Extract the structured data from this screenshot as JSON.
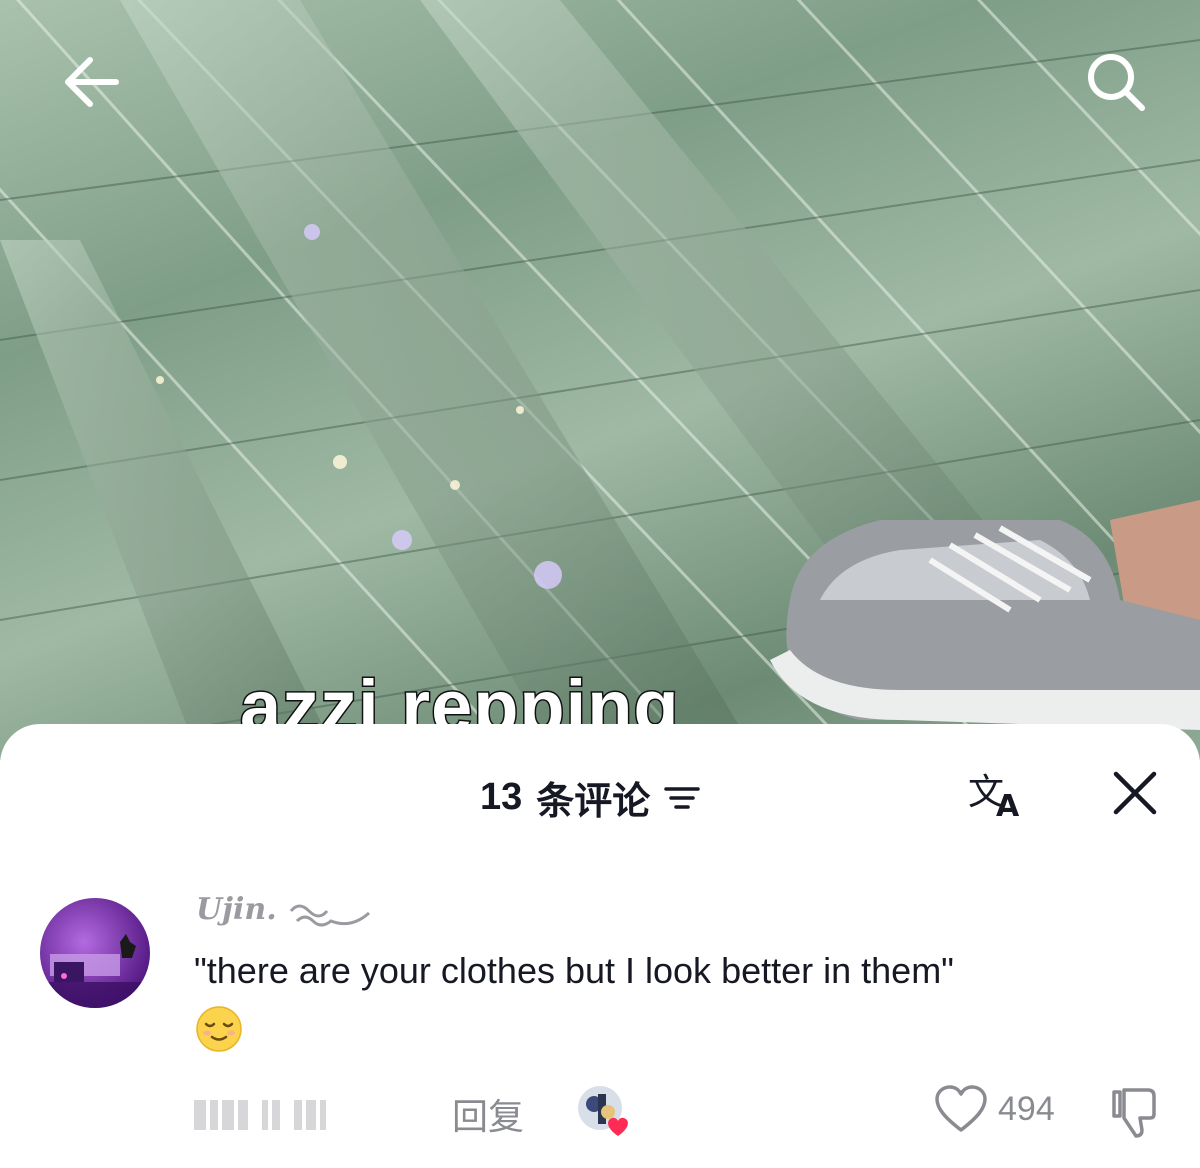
{
  "video": {
    "caption": "azzi repping",
    "back_icon": "arrow-left-icon",
    "search_icon": "search-icon"
  },
  "comments_panel": {
    "count": "13",
    "title": "条评论",
    "sort_icon": "sort-lines-icon",
    "translate_icon": "translate-icon",
    "close_icon": "close-icon"
  },
  "comment": {
    "username": "Ujin.",
    "text": "\"there are your clothes but I look better in them\"",
    "emoji": "relieved-face-emoji",
    "reply_label": "回复",
    "like_count": "494",
    "colors": {
      "text": "#161823",
      "muted": "#8a8b91",
      "heart_badge": "#fe2c55"
    }
  }
}
